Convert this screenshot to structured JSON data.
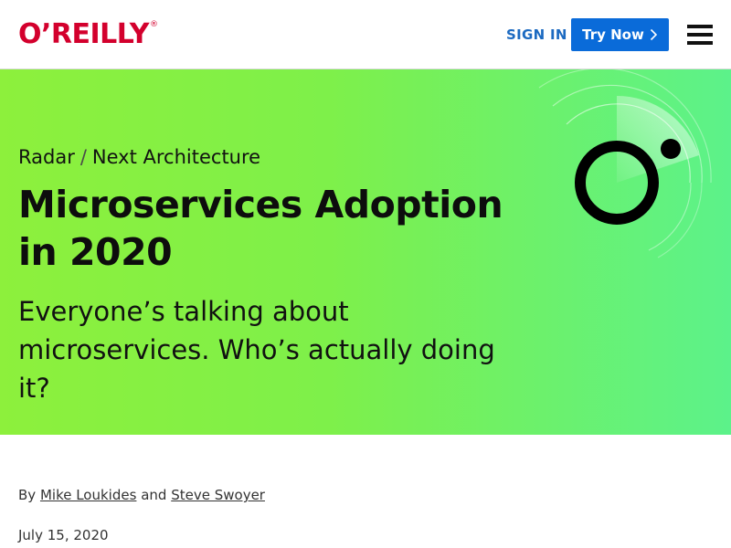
{
  "header": {
    "logo_text": "O’REILLY",
    "logo_registered": "®",
    "signin_label": "SIGN IN",
    "trynow_label": "Try Now",
    "menu_icon": "hamburger-menu-icon"
  },
  "hero": {
    "breadcrumb": [
      "Radar",
      "Next Architecture"
    ],
    "breadcrumb_separator": "/",
    "title": "Microservices Adoption in 2020",
    "subtitle": "Everyone’s talking about microservices. Who’s actually doing it?",
    "radar_icon": "radar-icon"
  },
  "article": {
    "by_prefix": "By",
    "authors": [
      "Mike Loukides",
      "Steve Swoyer"
    ],
    "author_joiner": "and",
    "date": "July 15, 2020"
  },
  "colors": {
    "brand_red": "#d3002d",
    "link_blue": "#1c6ac1",
    "button_blue": "#0a6bd9",
    "hero_gradient_start": "#8df03c",
    "hero_gradient_end": "#5cf28a"
  }
}
